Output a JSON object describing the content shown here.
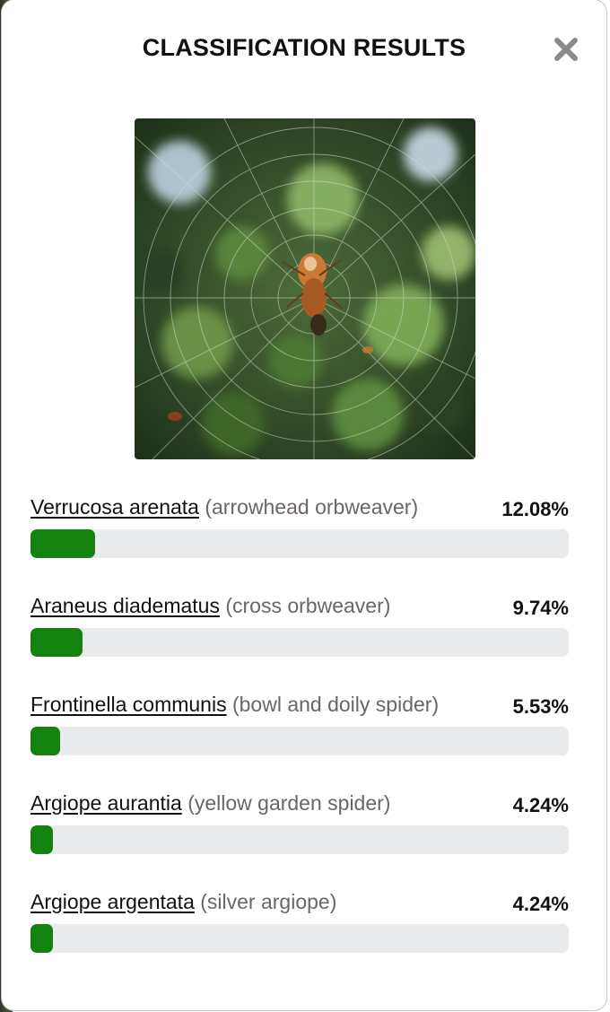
{
  "modal": {
    "title": "CLASSIFICATION RESULTS",
    "close_icon": "close-x-icon",
    "photo_subject": "spider-on-orb-web"
  },
  "colors": {
    "bar_fill": "#13820f",
    "bar_track": "#e8eaec",
    "common_name": "#6b6565"
  },
  "results": [
    {
      "scientific_name": "Verrucosa arenata",
      "common_name": "(arrowhead orbweaver)",
      "percent_label": "12.08%",
      "percent": 12.08
    },
    {
      "scientific_name": "Araneus diadematus",
      "common_name": "(cross orbweaver)",
      "percent_label": "9.74%",
      "percent": 9.74
    },
    {
      "scientific_name": "Frontinella communis",
      "common_name": "(bowl and doily spider)",
      "percent_label": "5.53%",
      "percent": 5.53
    },
    {
      "scientific_name": "Argiope aurantia",
      "common_name": "(yellow garden spider)",
      "percent_label": "4.24%",
      "percent": 4.24
    },
    {
      "scientific_name": "Argiope argentata",
      "common_name": "(silver argiope)",
      "percent_label": "4.24%",
      "percent": 4.24
    }
  ]
}
